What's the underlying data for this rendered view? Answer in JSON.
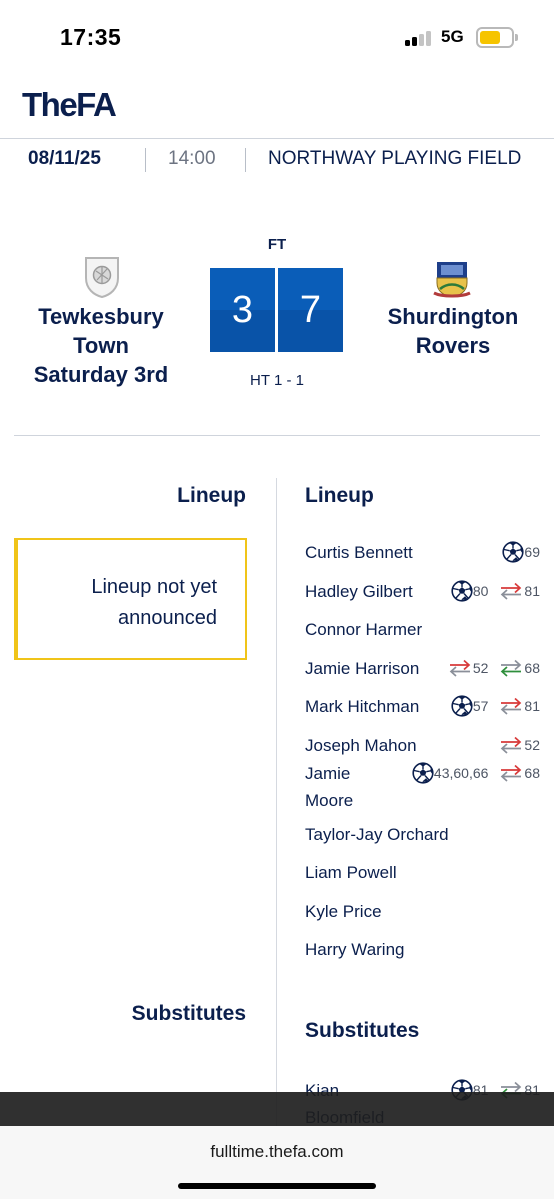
{
  "status_bar": {
    "time": "17:35",
    "network": "5G",
    "battery_color": "#f6c400"
  },
  "header": {
    "logo": "TheFA"
  },
  "match_info": {
    "date": "08/11/25",
    "kickoff": "14:00",
    "venue": "NORTHWAY PLAYING FIELD"
  },
  "score": {
    "status": "FT",
    "home_team": "Tewkesbury Town Saturday 3rd",
    "away_team": "Shurdington Rovers",
    "home_score": "3",
    "away_score": "7",
    "half_time": "HT 1 - 1",
    "accent_color": "#0a5db8"
  },
  "lineups": {
    "home": {
      "heading": "Lineup",
      "notice": "Lineup not yet announced",
      "subs_heading": "Substitutes"
    },
    "away": {
      "heading": "Lineup",
      "subs_heading": "Substitutes",
      "players": [
        {
          "name": "Curtis Bennett",
          "events": [
            {
              "type": "goal",
              "minute": "69"
            }
          ]
        },
        {
          "name": "Hadley Gilbert",
          "events": [
            {
              "type": "goal",
              "minute": "80"
            },
            {
              "type": "sub-off",
              "minute": "81"
            }
          ]
        },
        {
          "name": "Connor Harmer",
          "events": []
        },
        {
          "name": "Jamie Harrison",
          "events": [
            {
              "type": "sub-off",
              "minute": "52"
            },
            {
              "type": "sub-on",
              "minute": "68"
            }
          ]
        },
        {
          "name": "Mark Hitchman",
          "events": [
            {
              "type": "goal",
              "minute": "57"
            },
            {
              "type": "sub-off",
              "minute": "81"
            }
          ]
        },
        {
          "name": "Joseph Mahon",
          "events": [
            {
              "type": "sub-off",
              "minute": "52"
            }
          ]
        },
        {
          "name": "Jamie Moore",
          "events": [
            {
              "type": "goal",
              "minute": "43,60,66"
            },
            {
              "type": "sub-off",
              "minute": "68"
            }
          ]
        },
        {
          "name": "Taylor-Jay Orchard",
          "events": []
        },
        {
          "name": "Liam Powell",
          "events": []
        },
        {
          "name": "Kyle Price",
          "events": []
        },
        {
          "name": "Harry Waring",
          "events": []
        }
      ],
      "substitutes": [
        {
          "name": "Kian Bloomfield",
          "events": [
            {
              "type": "goal",
              "minute": "81"
            },
            {
              "type": "sub-on",
              "minute": "81"
            }
          ]
        }
      ]
    }
  },
  "browser": {
    "url": "fulltime.thefa.com"
  }
}
